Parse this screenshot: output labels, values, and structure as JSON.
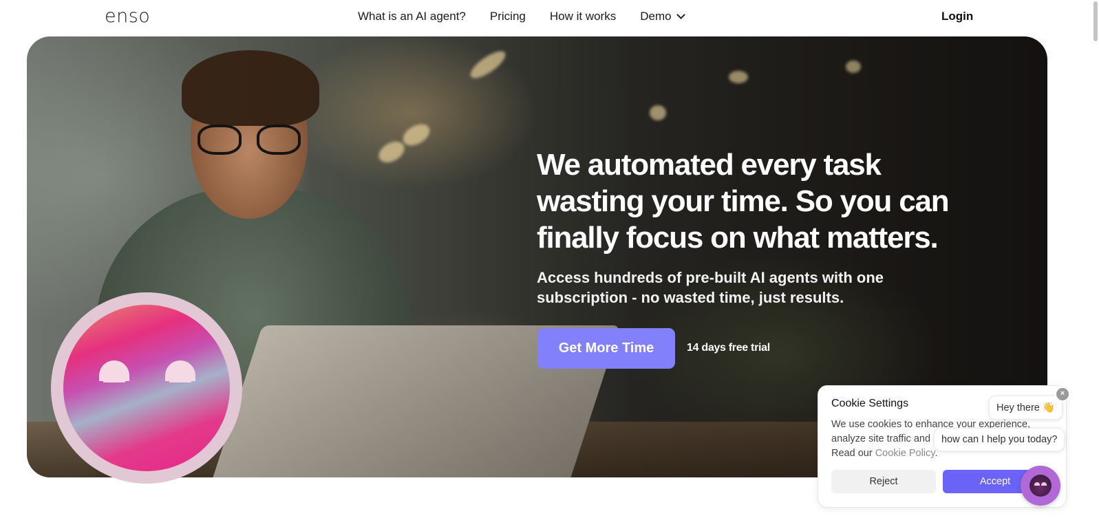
{
  "nav": {
    "logo": "enso",
    "links": [
      "What is an AI agent?",
      "Pricing",
      "How it works",
      "Demo"
    ],
    "login": "Login"
  },
  "hero": {
    "headline": "We automated every task wasting your time. So you can finally focus on what matters.",
    "subline": "Access hundreds of pre-built AI agents with one subscription - no wasted time, just results.",
    "cta": "Get More Time",
    "trial_note": "14 days free trial"
  },
  "cookie": {
    "title": "Cookie Settings",
    "text": "We use cookies to enhance your experience, analyze site traffic and personalize content. Read our",
    "link": "Cookie Policy",
    "period": ".",
    "reject": "Reject",
    "accept": "Accept"
  },
  "chat": {
    "greeting": "Hey there 👋",
    "prompt": "how can I help you today?",
    "close": "×"
  },
  "colors": {
    "cta": "#8280fb",
    "accept": "#6b63f5",
    "chat_launcher": "#b069d7"
  }
}
